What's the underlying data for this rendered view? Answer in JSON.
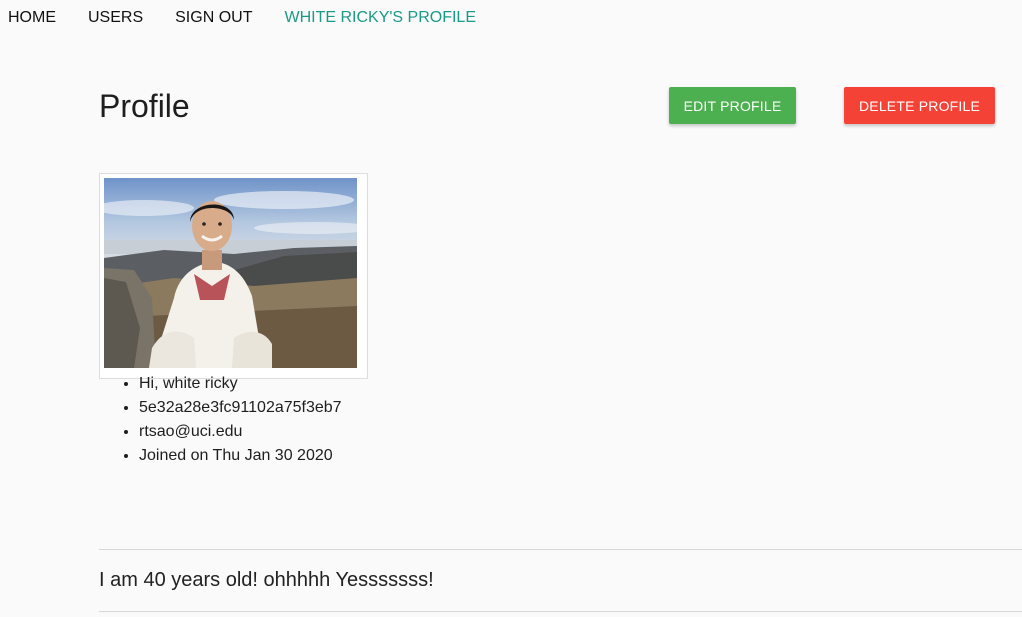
{
  "nav": {
    "home": "HOME",
    "users": "USERS",
    "sign_out": "SIGN OUT",
    "profile": "WHITE RICKY'S PROFILE"
  },
  "page": {
    "title": "Profile",
    "edit_label": "EDIT PROFILE",
    "delete_label": "DELETE PROFILE"
  },
  "user": {
    "greeting": "Hi, white ricky",
    "id": "5e32a28e3fc91102a75f3eb7",
    "email": "rtsao@uci.edu",
    "joined": "Joined on Thu Jan 30 2020",
    "bio": "I am 40 years old! ohhhhh Yesssssss!"
  },
  "colors": {
    "active_nav": "#1a9a86",
    "edit_button": "#4caf50",
    "delete_button": "#f44336"
  }
}
